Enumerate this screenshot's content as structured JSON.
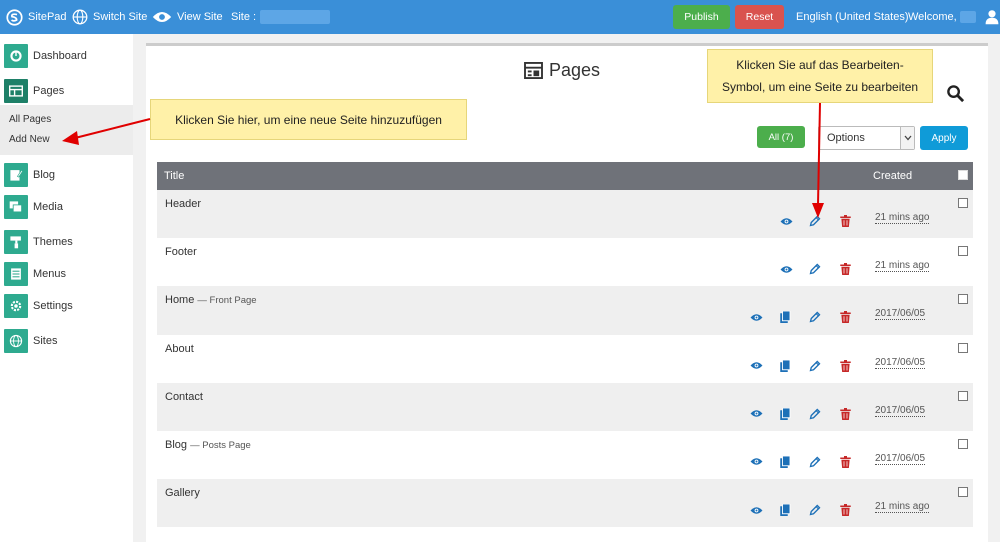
{
  "topbar": {
    "brand": "SitePad",
    "switch_site": "Switch Site",
    "view_site": "View Site",
    "site_label": "Site :",
    "publish": "Publish",
    "reset": "Reset",
    "language": "English (United States)",
    "welcome": "Welcome,"
  },
  "sidebar": {
    "items": [
      {
        "label": "Dashboard",
        "icon": "dashboard-icon"
      },
      {
        "label": "Pages",
        "icon": "pages-icon"
      },
      {
        "label": "Blog",
        "icon": "blog-icon"
      },
      {
        "label": "Media",
        "icon": "media-icon"
      },
      {
        "label": "Themes",
        "icon": "themes-icon"
      },
      {
        "label": "Menus",
        "icon": "menus-icon"
      },
      {
        "label": "Settings",
        "icon": "settings-icon"
      },
      {
        "label": "Sites",
        "icon": "sites-icon"
      }
    ],
    "submenu": [
      "All Pages",
      "Add New"
    ]
  },
  "main": {
    "title": "Pages",
    "filter_all": "All (7)",
    "options": "Options",
    "apply": "Apply",
    "columns": {
      "title": "Title",
      "created": "Created"
    },
    "rows": [
      {
        "title": "Header",
        "note": "",
        "created": "21 mins ago"
      },
      {
        "title": "Footer",
        "note": "",
        "created": "21 mins ago"
      },
      {
        "title": "Home",
        "note": "— Front Page",
        "created": "2017/06/05"
      },
      {
        "title": "About",
        "note": "",
        "created": "2017/06/05"
      },
      {
        "title": "Contact",
        "note": "",
        "created": "2017/06/05"
      },
      {
        "title": "Blog",
        "note": "— Posts Page",
        "created": "2017/06/05"
      },
      {
        "title": "Gallery",
        "note": "",
        "created": "21 mins ago"
      }
    ]
  },
  "callouts": {
    "add_new": "Klicken Sie hier, um eine neue Seite hinzuzufügen",
    "edit_line1": "Klicken Sie auf das Bearbeiten-",
    "edit_line2": "Symbol, um eine Seite zu bearbeiten"
  },
  "colors": {
    "topbar": "#3a8fd8",
    "sidebar_icon": "#2eaa8f",
    "publish": "#4cae4c",
    "reset": "#d9534f",
    "apply": "#0f9bd8",
    "table_header": "#6f7279",
    "callout": "#fff1a8",
    "arrow": "#e00000"
  }
}
